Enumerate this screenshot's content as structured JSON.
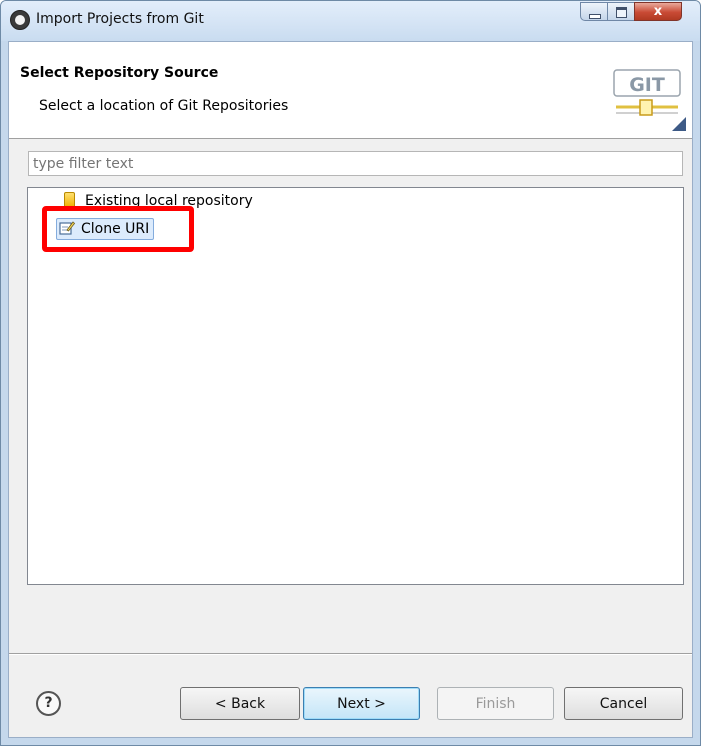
{
  "window": {
    "title": "Import Projects from Git",
    "close_glyph": "x"
  },
  "banner": {
    "title": "Select Repository Source",
    "description": "Select a location of Git Repositories",
    "logo_text": "GIT"
  },
  "filter": {
    "value": "",
    "placeholder": "type filter text"
  },
  "tree": {
    "items": [
      {
        "label": "Existing local repository",
        "icon": "repository-icon"
      },
      {
        "label": "Clone URI",
        "icon": "clone-uri-icon",
        "selected": true
      }
    ]
  },
  "buttons": {
    "help_glyph": "?",
    "back": "< Back",
    "next": "Next >",
    "finish": "Finish",
    "cancel": "Cancel"
  },
  "colors": {
    "highlight_box": "#ff0000",
    "titlebar": "#c9dcf0",
    "close_button": "#c94a35"
  }
}
